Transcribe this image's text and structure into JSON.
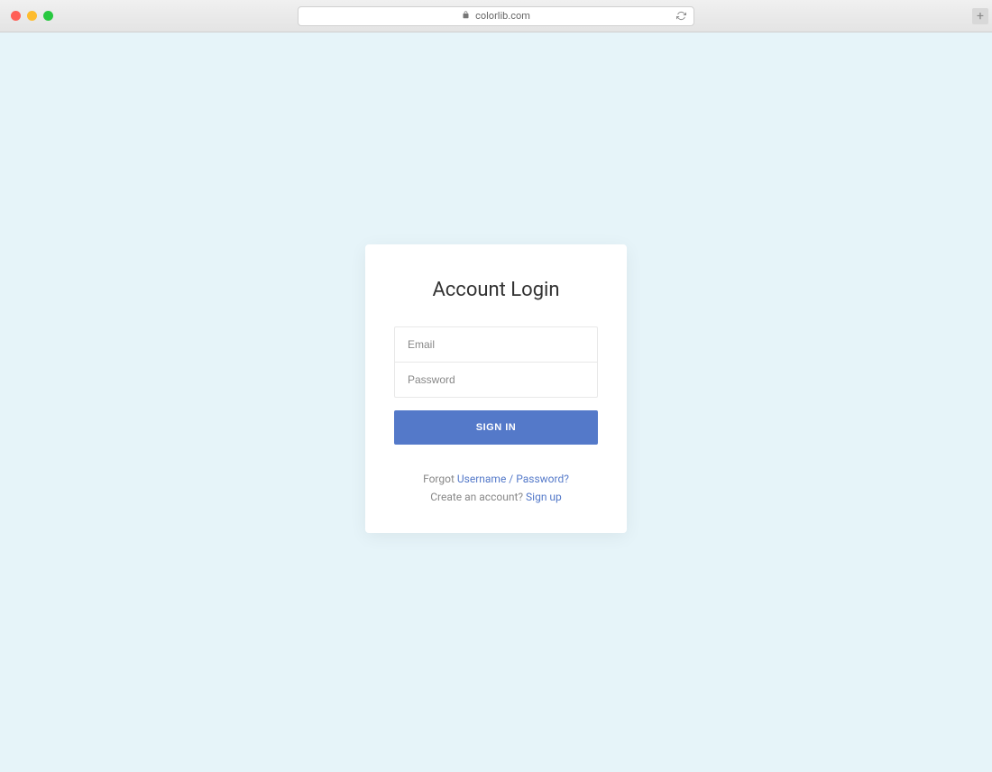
{
  "browser": {
    "url_display": "colorlib.com"
  },
  "login": {
    "title": "Account Login",
    "email_placeholder": "Email",
    "password_placeholder": "Password",
    "signin_label": "SIGN IN",
    "forgot_prefix": "Forgot ",
    "forgot_link": "Username / Password?",
    "create_prefix": "Create an account? ",
    "signup_link": "Sign up"
  }
}
